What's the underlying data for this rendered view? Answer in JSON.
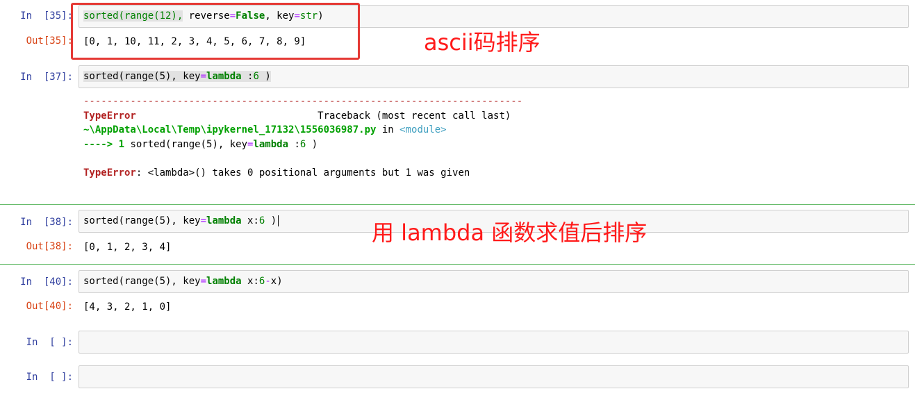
{
  "cells": [
    {
      "in_prompt": "In  [35]:",
      "out_prompt": "Out[35]:",
      "code": {
        "p1": "sorted(range(12),",
        "p2": " reverse",
        "p3": "=",
        "p4": "False",
        "p5": ", key",
        "p6": "=",
        "p7": "str",
        "p8": ")"
      },
      "output": "[0, 1, 10, 11, 2, 3, 4, 5, 6, 7, 8, 9]"
    },
    {
      "in_prompt": "In  [37]:",
      "code": {
        "p1": "sorted(range(5), key",
        "p2": "=",
        "p3": "lambda",
        "p4": " :",
        "p5": "6",
        "p6": " )"
      },
      "traceback": {
        "dashes": "---------------------------------------------------------------------------",
        "err_name": "TypeError",
        "tb_label": "                               Traceback (most recent call last)",
        "path": "~\\AppData\\Local\\Temp\\ipykernel_17132\\1556036987.py",
        "in_word": " in ",
        "module": "<module>",
        "arrow": "----> 1 ",
        "line_a": "sorted(range(5), key",
        "line_b": "=",
        "line_c": "lambda",
        "line_d": " :",
        "line_e": "6",
        "line_f": " )",
        "err_label": "TypeError",
        "err_msg": ": <lambda>() takes 0 positional arguments but 1 was given"
      }
    },
    {
      "in_prompt": "In  [38]:",
      "out_prompt": "Out[38]:",
      "code": {
        "p1": "sorted(range(5), key",
        "p2": "=",
        "p3": "lambda",
        "p4": " x:",
        "p5": "6",
        "p6": " )"
      },
      "output": "[0, 1, 2, 3, 4]"
    },
    {
      "in_prompt": "In  [40]:",
      "out_prompt": "Out[40]:",
      "code": {
        "p1": "sorted(range(5), key",
        "p2": "=",
        "p3": "lambda",
        "p4": " x:",
        "p5": "6",
        "p6": "-",
        "p7": "x)"
      },
      "output": "[4, 3, 2, 1, 0]"
    },
    {
      "in_prompt": "In  [ ]:"
    },
    {
      "in_prompt": "In  [ ]:"
    }
  ],
  "annotations": {
    "ascii": "ascii码排序",
    "lambda": "用 lambda 函数求值后排序"
  },
  "colors": {
    "annotation": "#ff1a1a",
    "in_prompt": "#303f9f",
    "out_prompt": "#d84315",
    "separator": "#66bb6a"
  }
}
